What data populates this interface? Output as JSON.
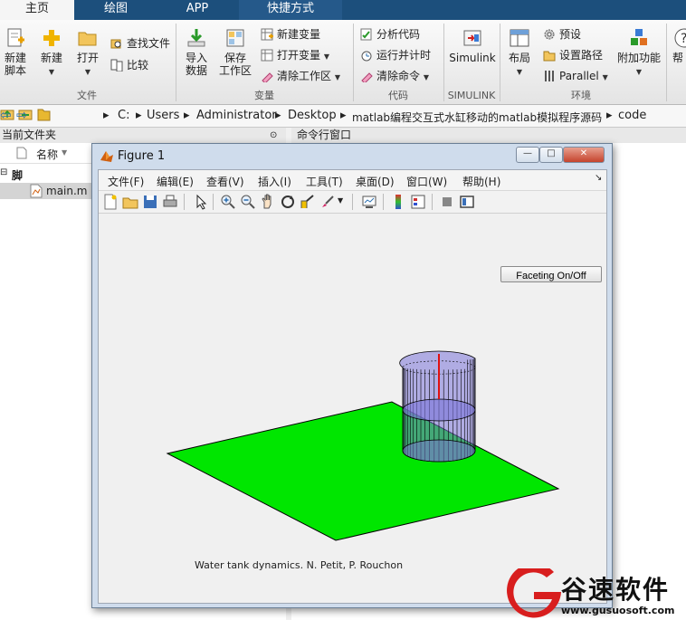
{
  "tabs": [
    {
      "label": "主页",
      "active": true
    },
    {
      "label": "绘图",
      "active": false
    },
    {
      "label": "APP",
      "active": false
    },
    {
      "label": "快捷方式",
      "active": false
    }
  ],
  "ribbon": {
    "file_group": {
      "label": "文件",
      "new_script": "新建\n脚本",
      "new": "新建",
      "open": "打开",
      "find_files": "查找文件",
      "compare": "比较"
    },
    "variable_group": {
      "label": "变量",
      "import_data": "导入\n数据",
      "save_workspace": "保存\n工作区",
      "new_variable": "新建变量",
      "open_variable": "打开变量",
      "clear_workspace": "清除工作区"
    },
    "code_group": {
      "label": "代码",
      "analyze_code": "分析代码",
      "run_and_time": "运行并计时",
      "clear_commands": "清除命令"
    },
    "simulink_group": {
      "label": "SIMULINK",
      "simulink": "Simulink"
    },
    "env_group": {
      "label": "环境",
      "layout": "布局",
      "preferences": "预设",
      "set_path": "设置路径",
      "parallel": "Parallel",
      "addons": "附加功能",
      "help": "帮"
    }
  },
  "address": {
    "segments": [
      "C:",
      "Users",
      "Administrator",
      "Desktop",
      "matlab编程交互式水缸移动的matlab模拟程序源码",
      "code"
    ]
  },
  "current_folder": {
    "title": "当前文件夹",
    "column_name": "名称",
    "group": "脚本",
    "files": [
      "main.m"
    ]
  },
  "command_window": {
    "title": "命令行窗口"
  },
  "figure": {
    "title": "Figure 1",
    "menus": [
      "文件(F)",
      "编辑(E)",
      "查看(V)",
      "插入(I)",
      "工具(T)",
      "桌面(D)",
      "窗口(W)",
      "帮助(H)"
    ],
    "faceting_button": "Faceting On/Off",
    "credit": "Water tank dynamics. N. Petit, P. Rouchon",
    "plane_color": "#00e600",
    "tank_color": "#7b74d8",
    "rod_color": "#e01010"
  },
  "watermark": {
    "brand": "谷速软件",
    "url": "www.gusuosoft.com",
    "color": "#d81e1e"
  },
  "colors": {
    "tabbar": "#1c4f7c",
    "accent": "#2a6fb0"
  }
}
